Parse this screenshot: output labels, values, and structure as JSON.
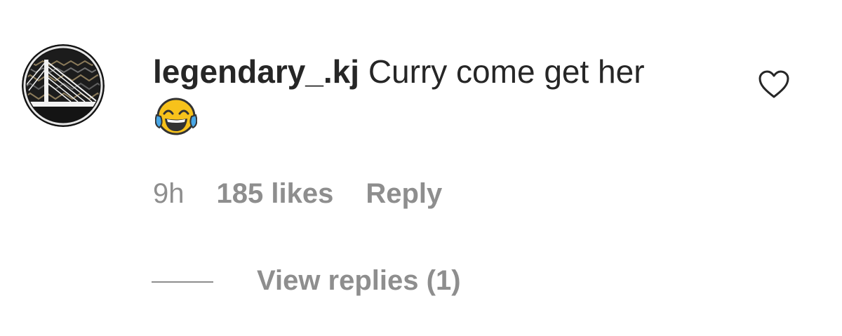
{
  "comment": {
    "username": "legendary_.kj",
    "text": "Curry come get her",
    "emoji": "😂",
    "avatar_icon": "bridge-logo-icon",
    "like_icon": "heart-outline-icon",
    "time": "9h",
    "likes": "185 likes",
    "reply_label": "Reply",
    "view_replies_label": "View replies (1)"
  },
  "colors": {
    "text_primary": "#262626",
    "text_secondary": "#8e8e8e",
    "background": "#ffffff"
  }
}
